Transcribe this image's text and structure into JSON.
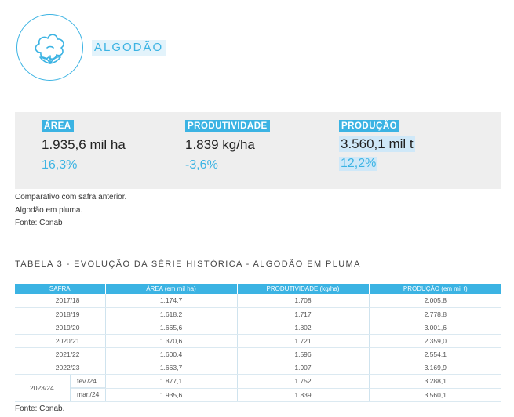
{
  "header": {
    "icon": "cotton-boll-icon",
    "crop_name": "ALGODÃO"
  },
  "summary": {
    "area": {
      "label": "ÁREA",
      "value": "1.935,6 mil ha",
      "change": "16,3%"
    },
    "productivity": {
      "label": "PRODUTIVIDADE",
      "value": "1.839 kg/ha",
      "change": "-3,6%"
    },
    "production": {
      "label": "PRODUÇÃO",
      "value": "3.560,1 mil t",
      "change": "12,2%"
    }
  },
  "notes": {
    "line1": "Comparativo com safra anterior.",
    "line2": "Algodão em pluma.",
    "line3": "Fonte: Conab"
  },
  "table": {
    "title": "TABELA 3 -  EVOLUÇÃO DA SÉRIE HISTÓRICA - ALGODÃO EM PLUMA",
    "headers": [
      "SAFRA",
      "ÁREA (em mil ha)",
      "PRODUTIVIDADE (kg/ha)",
      "PRODUÇÃO (em mil t)"
    ],
    "rows": [
      {
        "safra": "2017/18",
        "area": "1.174,7",
        "prod": "1.708",
        "producao": "2.005,8"
      },
      {
        "safra": "2018/19",
        "area": "1.618,2",
        "prod": "1.717",
        "producao": "2.778,8"
      },
      {
        "safra": "2019/20",
        "area": "1.665,6",
        "prod": "1.802",
        "producao": "3.001,6"
      },
      {
        "safra": "2020/21",
        "area": "1.370,6",
        "prod": "1.721",
        "producao": "2.359,0"
      },
      {
        "safra": "2021/22",
        "area": "1.600,4",
        "prod": "1.596",
        "producao": "2.554,1"
      },
      {
        "safra": "2022/23",
        "area": "1.663,7",
        "prod": "1.907",
        "producao": "3.169,9"
      }
    ],
    "current": {
      "safra": "2023/24",
      "estimates": [
        {
          "label": "fev./24",
          "area": "1.877,1",
          "prod": "1.752",
          "producao": "3.288,1"
        },
        {
          "label": "mar./24",
          "area": "1.935,6",
          "prod": "1.839",
          "producao": "3.560,1"
        }
      ]
    }
  },
  "footer": {
    "source": "Fonte: Conab."
  }
}
